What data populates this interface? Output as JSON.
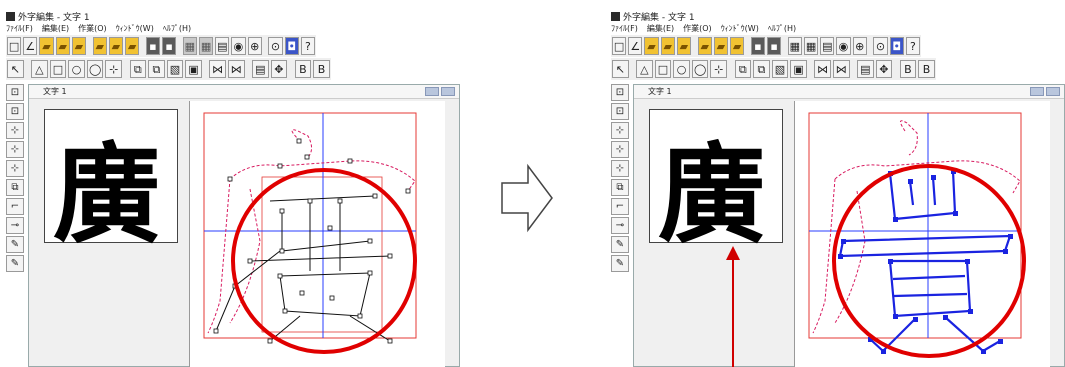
{
  "app": {
    "title": "外字編集 - 文字 1",
    "menus": [
      "ﾌｧｲﾙ(F)",
      "編集(E)",
      "作業(O)",
      "ｳｨﾝﾄﾞｳ(W)",
      "ﾍﾙﾌﾟ(H)"
    ]
  },
  "document": {
    "window_title": "文字 1",
    "glyph": "廣",
    "outline_glyph": "黄"
  },
  "colors": {
    "guide_box": "#e53935",
    "center_lines": "#2a3cff",
    "highlight_circle": "#e00000",
    "outline_black": "#111111",
    "outline_red": "#d81b60",
    "outline_blue": "#1a23e0",
    "pointer_arrow": "#d00000"
  }
}
